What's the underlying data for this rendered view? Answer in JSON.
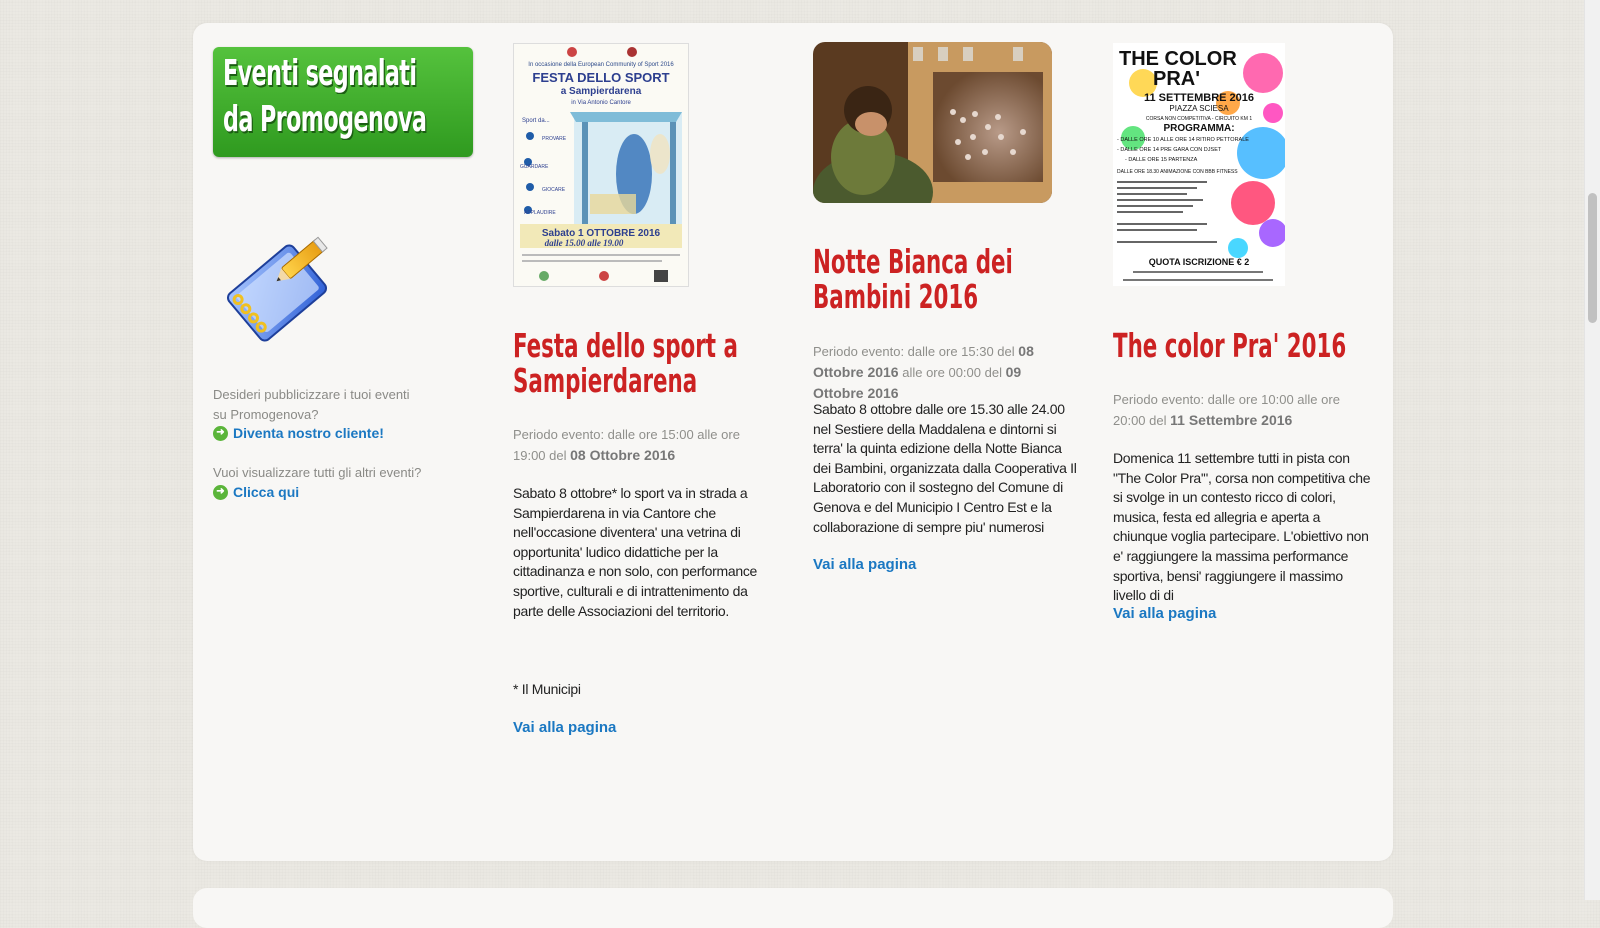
{
  "colors": {
    "accent_red": "#cc2222",
    "link_blue": "#1b78c2",
    "banner_green": "#3fae2a"
  },
  "sidebar": {
    "banner_line1": "Eventi segnalati",
    "banner_line2": "da Promogenova",
    "icon": "notebook-pencil-icon",
    "publicize_text": "Desideri pubblicizzare i tuoi eventi su Promogenova?",
    "publicize_link": "Diventa nostro cliente!",
    "all_events_text": "Vuoi visualizzare tutti gli altri eventi?",
    "all_events_link": "Clicca qui"
  },
  "events": [
    {
      "title": "Festa dello sport a Sampierdarena",
      "period_prefix": "Periodo evento: dalle ore 15:00 alle ore 19:00 del",
      "period_date": "08 Ottobre 2016",
      "description": "Sabato 8 ottobre* lo sport va in strada a Sampierdarena in via Cantore che nell'occasione diventera' una vetrina di opportunita' ludico didattiche per la cittadinanza e non solo, con performance sportive, culturali e di intrattenimento da parte delle Associazioni del territorio.",
      "footnote": "* Il Municipi",
      "link": "Vai alla pagina",
      "poster": {
        "l1": "In occasione della European Community of Sport 2016",
        "l2": "FESTA DELLO SPORT",
        "l3": "a Sampierdarena",
        "l4": "in Via Antonio Cantore",
        "l5": "Sport da...",
        "l6": "PROVARE",
        "l7": "GUARDARE",
        "l8": "GIOCARE",
        "l9": "APPLAUDIRE",
        "l10": "Sabato 1 OTTOBRE 2016",
        "l11": "dalle 15.00 alle 19.00"
      }
    },
    {
      "title": "Notte Bianca dei Bambini 2016",
      "period_prefix": "Periodo evento: dalle ore 15:30 del",
      "period_date": "08 Ottobre 2016",
      "period_mid": "alle ore 00:00 del",
      "period_date2": "09 Ottobre 2016",
      "description": "Sabato 8 ottobre dalle ore 15.30 alle 24.00 nel Sestiere della Maddalena e dintorni si terra' la quinta edizione della Notte Bianca dei Bambini, organizzata dalla Cooperativa Il Laboratorio con il sostegno del Comune di Genova e del Municipio I Centro Est e la collaborazione di sempre piu' numerosi",
      "link": "Vai alla pagina"
    },
    {
      "title": "The color Pra' 2016",
      "period_prefix": "Periodo evento: dalle ore 10:00 alle ore 20:00 del",
      "period_date": "11 Settembre 2016",
      "description": "Domenica 11 settembre tutti in pista con \"The Color Pra'\", corsa non competitiva che si svolge in un contesto ricco di colori, musica, festa ed allegria e aperta a chiunque voglia partecipare. L'obiettivo non e' raggiungere la massima performance sportiva, bensi' raggiungere il massimo livello di di",
      "link": "Vai alla pagina",
      "poster": {
        "l1": "THE COLOR",
        "l2": "PRA'",
        "l3": "11 SETTEMBRE 2016",
        "l4": "PIAZZA SCIESA",
        "l5": "CORSA NON COMPETITIVA - CIRCUITO KM 1",
        "l6": "PROGRAMMA:",
        "l7": "- DALLE ORE 10 ALLE ORE 14 RITIRO PETTORALE",
        "l8": "- DALLE ORE 14 PRE GARA CON DJSET",
        "l9": "- DALLE ORE 15 PARTENZA",
        "l10": "DALLE ORE 18.30 ANIMAZIONE CON BBB FITNESS",
        "l11": "QUOTA ISCRIZIONE € 2"
      }
    }
  ]
}
